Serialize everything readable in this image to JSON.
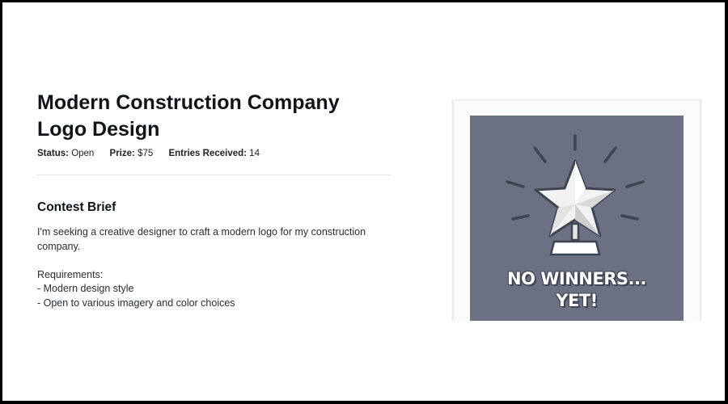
{
  "contest": {
    "title": "Modern Construction Company Logo Design",
    "status_label": "Status:",
    "status_value": "Open",
    "prize_label": "Prize:",
    "prize_value": "$75",
    "entries_label": "Entries Received:",
    "entries_value": "14"
  },
  "brief": {
    "heading": "Contest Brief",
    "intro": "I'm seeking a creative designer to craft a modern logo for my construction company.",
    "requirements_heading": "Requirements:",
    "requirements": [
      "- Modern design style",
      "- Open to various imagery and color choices"
    ]
  },
  "winner_card": {
    "line1": "NO WINNERS...",
    "line2": "YET!",
    "icon": "trophy-star-icon",
    "background_color": "#6b7183",
    "star_color": "#f2f2f2"
  }
}
